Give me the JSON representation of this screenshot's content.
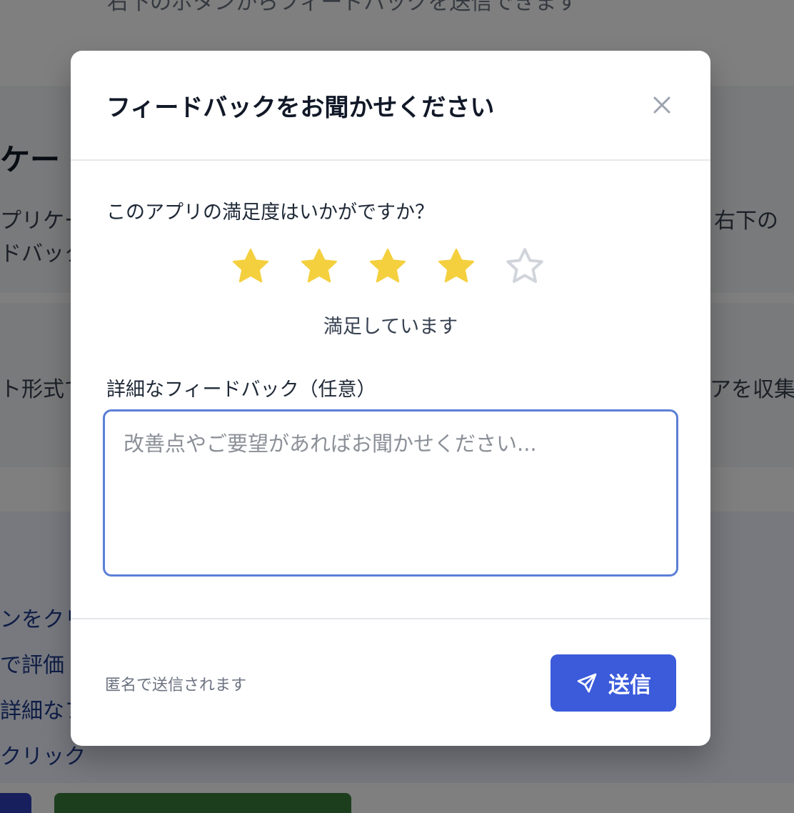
{
  "background": {
    "top_text": "右下のボタンからフィードバックを送信できます",
    "section_title": "ケー",
    "line1_left": "プリケー",
    "line1_right": "右下の",
    "line2_left": "ドバック",
    "line3_left": "ト形式で",
    "line3_right": "アを収集",
    "steps": [
      "ンをクリ",
      "で評価",
      "詳細なフ",
      "クリック"
    ]
  },
  "modal": {
    "title": "フィードバックをお聞かせください",
    "question": "このアプリの満足度はいかがですか？",
    "rating": {
      "value": 4,
      "max": 5,
      "label": "満足しています",
      "filled_color": "#f4d03f",
      "empty_color": "#d1d5db"
    },
    "detail_label": "詳細なフィードバック（任意）",
    "textarea_placeholder": "改善点やご要望があればお聞かせください...",
    "anonymous_note": "匿名で送信されます",
    "submit_label": "送信",
    "accent_color": "#3b5bdb"
  }
}
